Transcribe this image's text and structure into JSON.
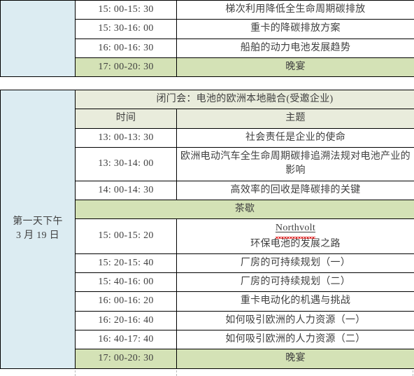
{
  "document": {
    "type": "conference-agenda-tables",
    "colors": {
      "day_column_bg": "#dcecf2",
      "highlight_bg": "#d4e2b6",
      "header_band_bg": "#e9ecdc",
      "border": "#000000",
      "text": "#3f3f3f",
      "spellcheck_underline": "#e02020",
      "gridline": "#b9b9b9"
    }
  },
  "table_top": {
    "rows": [
      {
        "time": "15: 00-15: 30",
        "topic": "梯次利用降低全生命周期碳排放",
        "highlight": false
      },
      {
        "time": "15: 30-16: 00",
        "topic": "重卡的降碳排放方案",
        "highlight": false
      },
      {
        "time": "16: 00-16: 30",
        "topic": "船舶的动力电池发展趋势",
        "highlight": false
      },
      {
        "time": "17: 00-20: 30",
        "topic": "晚宴",
        "highlight": true
      }
    ]
  },
  "table_bottom": {
    "day_label_line1": "第一天下午",
    "day_label_line2": "3 月 19 日",
    "banner": "闭门会：电池的欧洲本地融合(受邀企业)",
    "columns": {
      "time": "时间",
      "topic": "主题"
    },
    "rows": [
      {
        "time": "13: 00-13: 30",
        "topic": "社会责任是企业的使命",
        "highlight": false
      },
      {
        "time": "13: 30-14: 00",
        "topic": "欧洲电动汽车全生命周期碳排追溯法规对电池产业的影响",
        "highlight": false
      },
      {
        "time": "14: 00-14: 30",
        "topic": "高效率的回收是降碳排的关键",
        "highlight": false
      }
    ],
    "break_row": {
      "label": "茶歇",
      "highlight": true
    },
    "rows_after_break": [
      {
        "time": "15: 00-15: 20",
        "topic_title": "Northvolt",
        "topic_sub": "环保电池的发展之路",
        "highlight": false,
        "spellcheck": true
      },
      {
        "time": "15: 20-15: 40",
        "topic": "厂房的可持续规划（一）",
        "highlight": false
      },
      {
        "time": "15: 40-16: 00",
        "topic": "厂房的可持续规划（二）",
        "highlight": false
      },
      {
        "time": "16: 00-16: 20",
        "topic": "重卡电动化的机遇与挑战",
        "highlight": false
      },
      {
        "time": "16: 20-16: 40",
        "topic": "如何吸引欧洲的人力资源（一）",
        "highlight": false
      },
      {
        "time": "16: 40-17: 40",
        "topic": "如何吸引欧洲的人力资源（二）",
        "highlight": false
      },
      {
        "time": "17: 00-20: 30",
        "topic": "晚宴",
        "highlight": true
      }
    ]
  }
}
